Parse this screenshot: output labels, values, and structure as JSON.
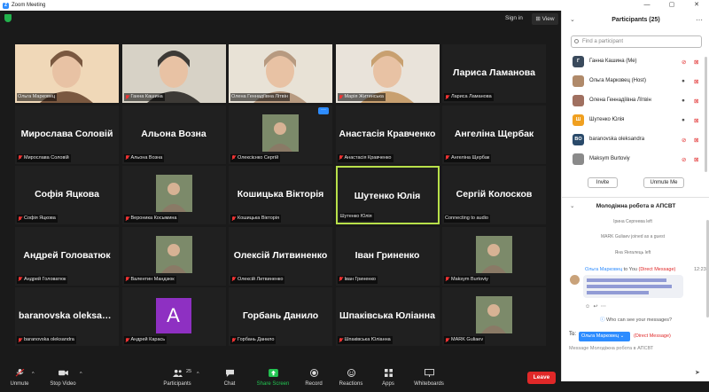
{
  "window": {
    "title": "Zoom Meeting",
    "controls": [
      "—",
      "▢",
      "✕"
    ]
  },
  "topbar": {
    "signin": "Sign in",
    "view": "⊞ View"
  },
  "tiles": [
    {
      "name": "Ольга Марковец",
      "caption": "Ольга Марковец",
      "video": true,
      "muted": false
    },
    {
      "name": "Ганна Кашина",
      "caption": "Ганна Кашина",
      "video": true,
      "muted": true
    },
    {
      "name": "Олена Геннадіївна Літвін",
      "caption": "Олена Геннадіївна Літвін",
      "video": true,
      "muted": false
    },
    {
      "name": "Марія Житинська",
      "caption": "Марія Житинська",
      "video": true,
      "muted": true
    },
    {
      "name": "Лариса Ламанова",
      "caption": "Лариса Ламанова",
      "video": false,
      "muted": true
    },
    {
      "name": "Мирослава Соловій",
      "caption": "Мирослава Соловій",
      "video": false,
      "muted": true
    },
    {
      "name": "Альона Возна",
      "caption": "Альона Возна",
      "video": false,
      "muted": true
    },
    {
      "name": "Олексієнко Сергій",
      "caption": "Олексієнко Сергій",
      "video": true,
      "muted": true
    },
    {
      "name": "Анастасія Кравченко",
      "caption": "Анастасія Кравченко",
      "video": false,
      "muted": true
    },
    {
      "name": "Ангеліна Щербак",
      "caption": "Ангеліна Щербак",
      "video": false,
      "muted": true
    },
    {
      "name": "Софія Яцкова",
      "caption": "Софія Яцкова",
      "video": false,
      "muted": true
    },
    {
      "name": "Вероника Косымина",
      "caption": "Вероника Косымина",
      "video": true,
      "muted": true
    },
    {
      "name": "Кошицька Вікторія",
      "caption": "Кошицька Вікторія",
      "video": false,
      "muted": true
    },
    {
      "name": "Шутенко Юлія",
      "caption": "Шутенко Юлія",
      "video": false,
      "muted": false,
      "active": true
    },
    {
      "name": "Сергій Колосков",
      "caption": "Connecting to audio",
      "video": false,
      "muted": false
    },
    {
      "name": "Андрей Головатюк",
      "caption": "Андрей Головатюк",
      "video": false,
      "muted": true
    },
    {
      "name": "Валентин Мандзюк",
      "caption": "Валентин Мандзюк",
      "video": true,
      "muted": true
    },
    {
      "name": "Олексій Литвиненко",
      "caption": "Олексій Литвиненко",
      "video": false,
      "muted": true
    },
    {
      "name": "Іван Гриненко",
      "caption": "Іван Гриненко",
      "video": false,
      "muted": true
    },
    {
      "name": "Maksym Burtoviy",
      "caption": "Maksym Burtoviy",
      "video": true,
      "muted": true
    },
    {
      "name": "baranovska oleksandra",
      "caption": "baranovska oleksandra",
      "video": false,
      "muted": true
    },
    {
      "name": "Андрей Карась",
      "caption": "Андрей Карась",
      "video": false,
      "muted": true,
      "avatar": "A"
    },
    {
      "name": "Горбань Данило",
      "caption": "Горбань Данило",
      "video": false,
      "muted": true
    },
    {
      "name": "Шпаківська Юліанна",
      "caption": "Шпаківська Юліанна",
      "video": false,
      "muted": true
    },
    {
      "name": "MARK Guliaev",
      "caption": "MARK Guliaev",
      "video": true,
      "muted": true
    }
  ],
  "toolbar": {
    "unmute": "Unmute",
    "stop_video": "Stop Video",
    "participants": "Participants",
    "participants_count": "25",
    "chat": "Chat",
    "share": "Share Screen",
    "record": "Record",
    "reactions": "Reactions",
    "apps": "Apps",
    "whiteboards": "Whiteboards",
    "leave": "Leave"
  },
  "participants_panel": {
    "title": "Participants (25)",
    "search_placeholder": "Find a participant",
    "rows": [
      {
        "initial": "Г",
        "color": "#3a4a5c",
        "name": "Ганна Кашина (Me)"
      },
      {
        "initial": "",
        "color": "#b08a6a",
        "name": "Ольга Марковец (Host)"
      },
      {
        "initial": "",
        "color": "#a07060",
        "name": "Олена Геннадіївна Літвін"
      },
      {
        "initial": "Ш",
        "color": "#f0a020",
        "name": "Шутенко Юлія"
      },
      {
        "initial": "BO",
        "color": "#2a4a6a",
        "name": "baranovska oleksandra"
      },
      {
        "initial": "",
        "color": "#8a8a8a",
        "name": "Maksym Burtoviy"
      }
    ],
    "invite": "Invite",
    "unmute_me": "Unmute Me"
  },
  "chat": {
    "title": "Молодіжна робота в АПСВТ",
    "system": [
      "Ірина Сергеева left",
      "MARK Guliaev joined as a guest",
      "Яна Янгалець left"
    ],
    "from": "Ольга Марковец",
    "to_you": "to You",
    "direct": "(Direct Message)",
    "time": "12:23",
    "who_can_see": "Who can see your messages?",
    "to_label": "To:",
    "to_target": "Ольга Марковец",
    "to_direct": "(Direct Message)",
    "input_placeholder": "Message Молодіжна робота в АПСВТ"
  }
}
